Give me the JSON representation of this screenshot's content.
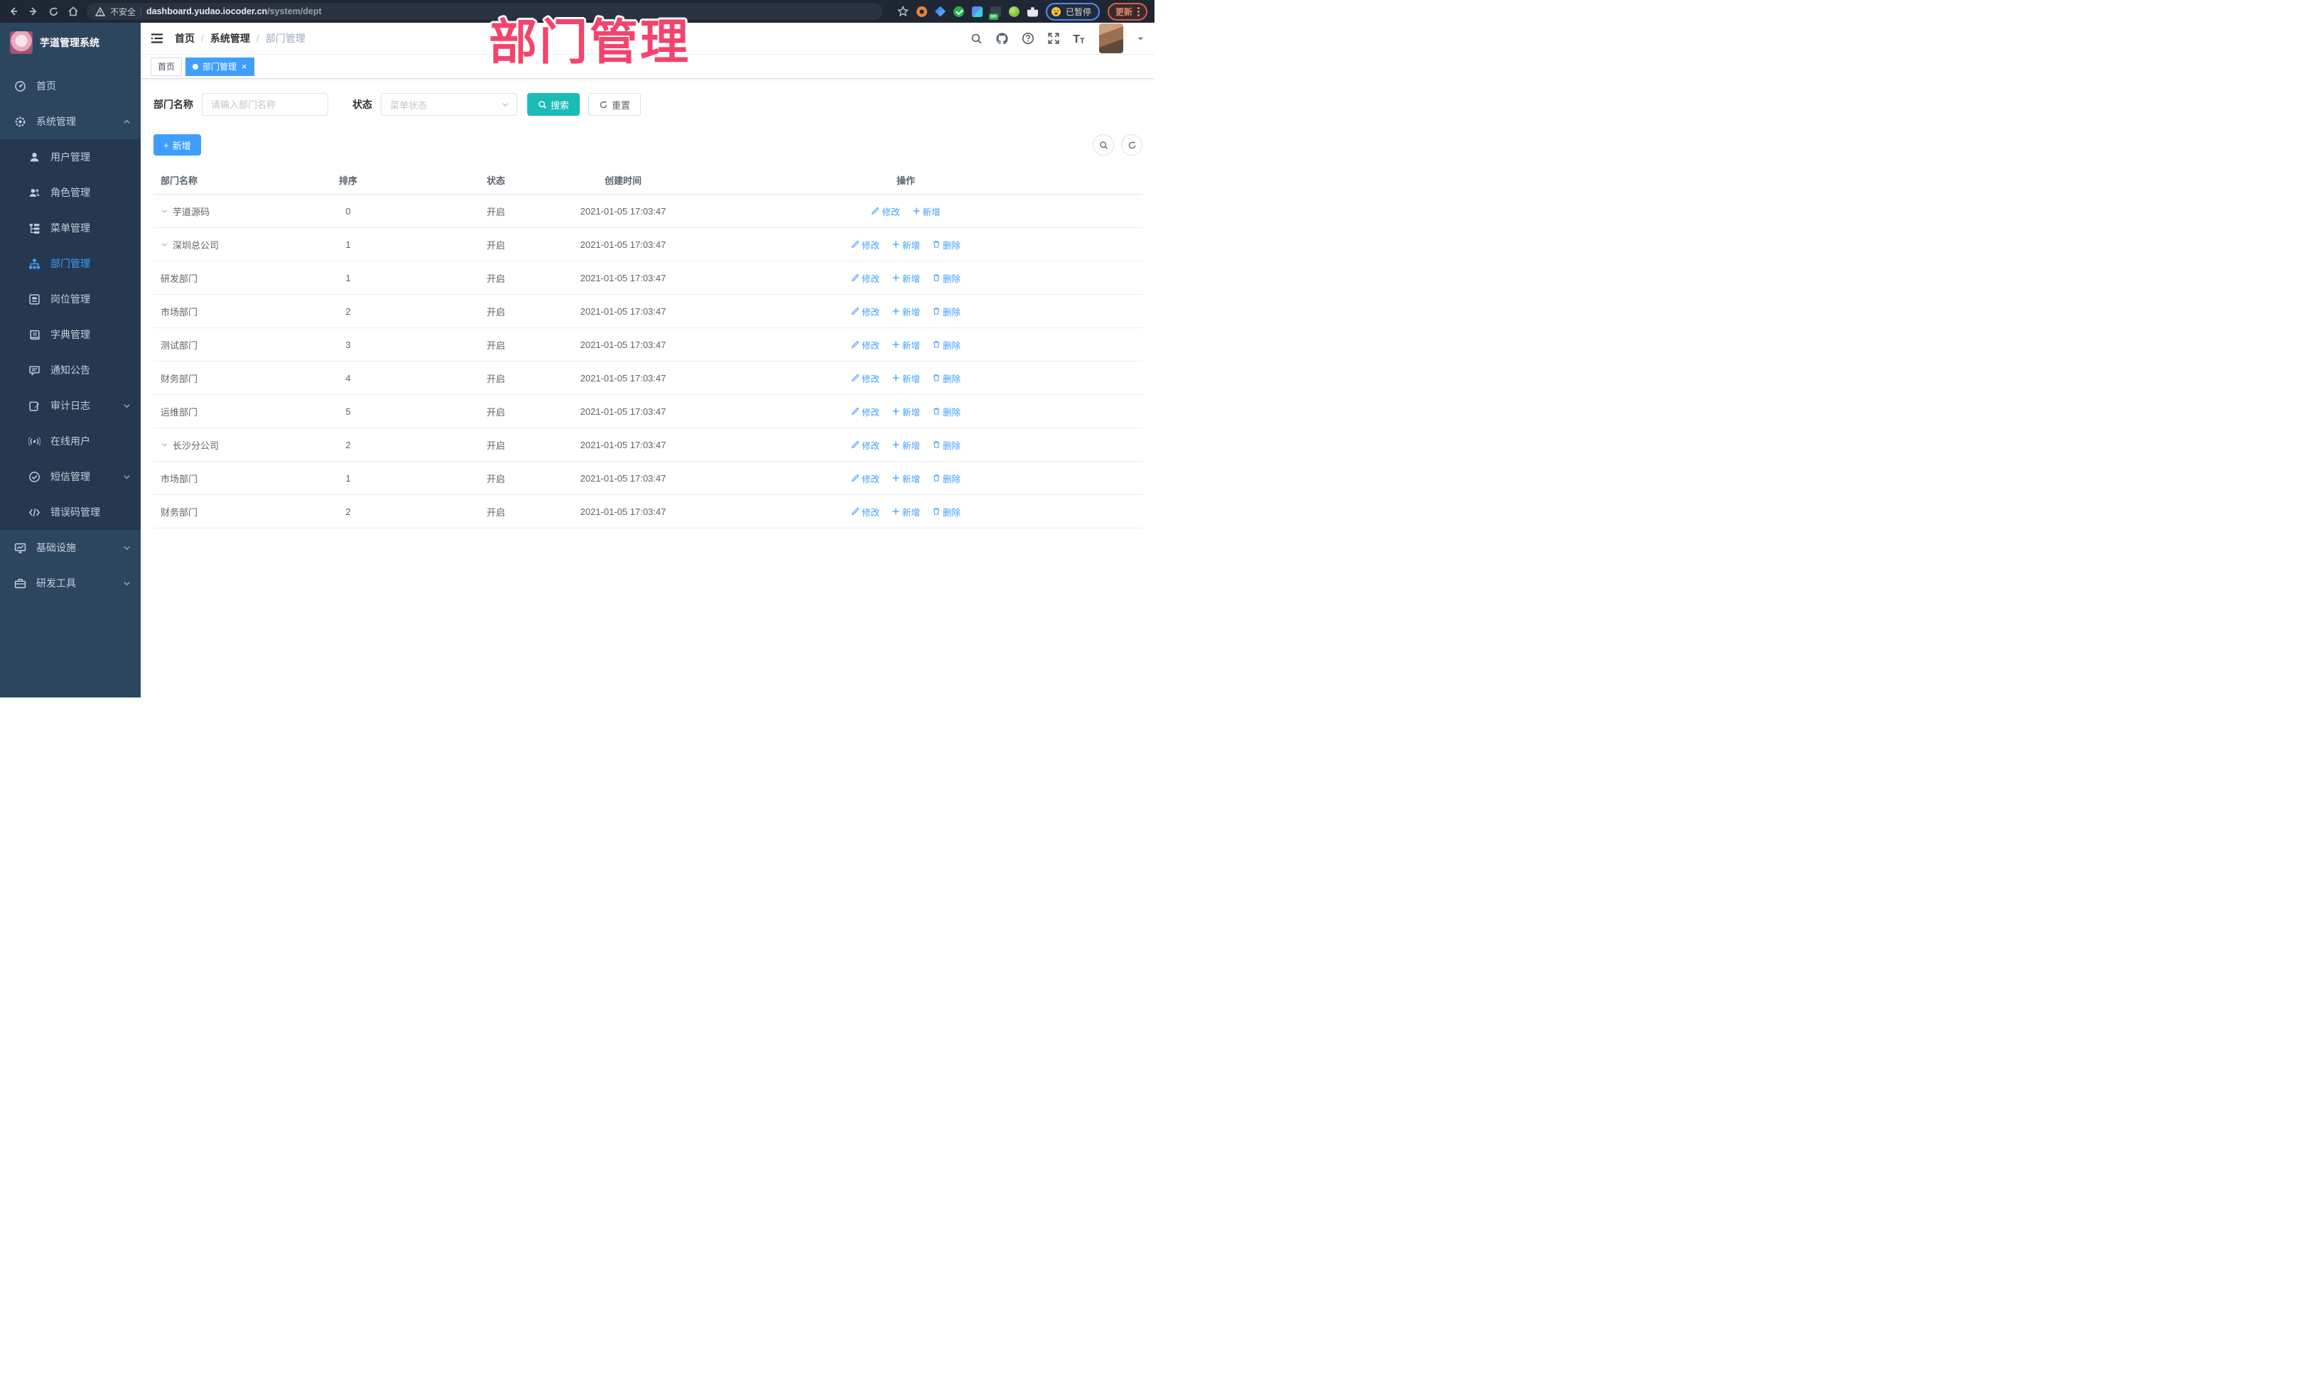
{
  "overlay": {
    "title": "部门管理",
    "color": "#f4436c"
  },
  "browser": {
    "security_label": "不安全",
    "url_host": "dashboard.yudao.iocoder.cn",
    "url_path": "/system/dept",
    "paused_label": "已暂停",
    "update_label": "更新",
    "nav_icons": [
      "back-icon",
      "forward-icon",
      "reload-icon",
      "home-icon",
      "bookmark-star-icon",
      "extensions",
      "kebab-menu-icon"
    ]
  },
  "sidebar": {
    "app_title": "芋道管理系统",
    "items": [
      {
        "label": "首页",
        "icon": "dashboard-icon",
        "level": 0
      },
      {
        "label": "系统管理",
        "icon": "gear-icon",
        "level": 0,
        "expanded": true
      },
      {
        "label": "用户管理",
        "icon": "user-icon",
        "level": 1
      },
      {
        "label": "角色管理",
        "icon": "peoples-icon",
        "level": 1
      },
      {
        "label": "菜单管理",
        "icon": "menu-tree-icon",
        "level": 1
      },
      {
        "label": "部门管理",
        "icon": "org-tree-icon",
        "level": 1,
        "active": true
      },
      {
        "label": "岗位管理",
        "icon": "post-icon",
        "level": 1
      },
      {
        "label": "字典管理",
        "icon": "dict-icon",
        "level": 1
      },
      {
        "label": "通知公告",
        "icon": "announcement-icon",
        "level": 1
      },
      {
        "label": "审计日志",
        "icon": "audit-log-icon",
        "level": 1,
        "chevron": "down"
      },
      {
        "label": "在线用户",
        "icon": "online-user-icon",
        "level": 1
      },
      {
        "label": "短信管理",
        "icon": "sms-icon",
        "level": 1,
        "chevron": "down"
      },
      {
        "label": "错误码管理",
        "icon": "error-code-icon",
        "level": 1
      },
      {
        "label": "基础设施",
        "icon": "infra-icon",
        "level": 0,
        "chevron": "down"
      },
      {
        "label": "研发工具",
        "icon": "devtools-icon",
        "level": 0,
        "chevron": "down"
      }
    ]
  },
  "header": {
    "breadcrumb": [
      "首页",
      "系统管理",
      "部门管理"
    ],
    "right_icons": [
      "search-icon",
      "github-icon",
      "help-icon",
      "fullscreen-icon",
      "font-size-icon",
      "user-avatar",
      "caret-down-icon"
    ]
  },
  "tabs": [
    {
      "label": "首页",
      "active": false
    },
    {
      "label": "部门管理",
      "active": true,
      "closable": true
    }
  ],
  "filters": {
    "dept_name_label": "部门名称",
    "dept_name_placeholder": "请输入部门名称",
    "status_label": "状态",
    "status_placeholder": "菜单状态",
    "search_label": "搜索",
    "reset_label": "重置"
  },
  "toolbar": {
    "add_label": "新增"
  },
  "table": {
    "columns": [
      "部门名称",
      "排序",
      "状态",
      "创建时间",
      "操作"
    ],
    "action_labels": {
      "edit": "修改",
      "add": "新增",
      "delete": "删除"
    },
    "rows": [
      {
        "name": "芋道源码",
        "level": 0,
        "expandable": true,
        "sort": "0",
        "status": "开启",
        "created": "2021-01-05 17:03:47",
        "actions": [
          "edit",
          "add"
        ]
      },
      {
        "name": "深圳总公司",
        "level": 1,
        "expandable": true,
        "sort": "1",
        "status": "开启",
        "created": "2021-01-05 17:03:47",
        "actions": [
          "edit",
          "add",
          "delete"
        ]
      },
      {
        "name": "研发部门",
        "level": 2,
        "expandable": false,
        "sort": "1",
        "status": "开启",
        "created": "2021-01-05 17:03:47",
        "actions": [
          "edit",
          "add",
          "delete"
        ]
      },
      {
        "name": "市场部门",
        "level": 2,
        "expandable": false,
        "sort": "2",
        "status": "开启",
        "created": "2021-01-05 17:03:47",
        "actions": [
          "edit",
          "add",
          "delete"
        ]
      },
      {
        "name": "测试部门",
        "level": 2,
        "expandable": false,
        "sort": "3",
        "status": "开启",
        "created": "2021-01-05 17:03:47",
        "actions": [
          "edit",
          "add",
          "delete"
        ]
      },
      {
        "name": "财务部门",
        "level": 2,
        "expandable": false,
        "sort": "4",
        "status": "开启",
        "created": "2021-01-05 17:03:47",
        "actions": [
          "edit",
          "add",
          "delete"
        ]
      },
      {
        "name": "运维部门",
        "level": 2,
        "expandable": false,
        "sort": "5",
        "status": "开启",
        "created": "2021-01-05 17:03:47",
        "actions": [
          "edit",
          "add",
          "delete"
        ]
      },
      {
        "name": "长沙分公司",
        "level": 1,
        "expandable": true,
        "sort": "2",
        "status": "开启",
        "created": "2021-01-05 17:03:47",
        "actions": [
          "edit",
          "add",
          "delete"
        ]
      },
      {
        "name": "市场部门",
        "level": 2,
        "expandable": false,
        "sort": "1",
        "status": "开启",
        "created": "2021-01-05 17:03:47",
        "actions": [
          "edit",
          "add",
          "delete"
        ]
      },
      {
        "name": "财务部门",
        "level": 2,
        "expandable": false,
        "sort": "2",
        "status": "开启",
        "created": "2021-01-05 17:03:47",
        "actions": [
          "edit",
          "add",
          "delete"
        ]
      }
    ]
  },
  "glyphs": {
    "plus": "+",
    "close": "×",
    "slash": "/",
    "font_large": "T",
    "font_small": "T"
  },
  "colors": {
    "accent_blue": "#409eff",
    "search_teal": "#1abcb4",
    "annotation_pink": "#f4436c",
    "sidebar_bg": "#2d4660",
    "submenu_bg": "#24394f",
    "chrome_bg": "#202734"
  }
}
